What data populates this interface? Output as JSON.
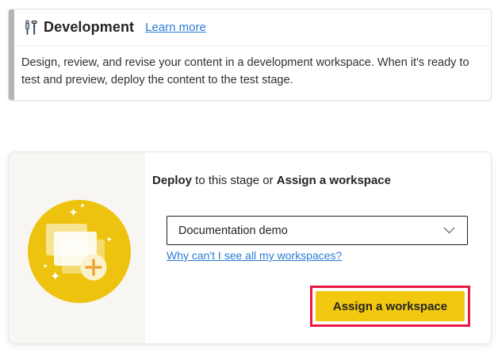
{
  "colors": {
    "brand_yellow": "#F2C811",
    "illustration_yellow": "#EDC30F",
    "highlight_red": "#E81A45",
    "link_blue": "#2B7CD3",
    "accent_bar_gray": "#B8B5B1"
  },
  "dev_card": {
    "icon": "development-tools-icon",
    "title": "Development",
    "learn_more_label": "Learn more",
    "description": "Design, review, and revise your content in a development workspace. When it's ready to test and preview, deploy the content to the test stage."
  },
  "stage_card": {
    "illustration": "workspace-stack-illustration",
    "heading": {
      "deploy": "Deploy",
      "connector": " to this stage or ",
      "assign": "Assign a workspace"
    },
    "workspace_dropdown": {
      "value": "Documentation demo",
      "chevron": "chevron-down-icon"
    },
    "workspaces_link_label": "Why can't I see all my workspaces?",
    "assign_button_label": "Assign a workspace"
  }
}
